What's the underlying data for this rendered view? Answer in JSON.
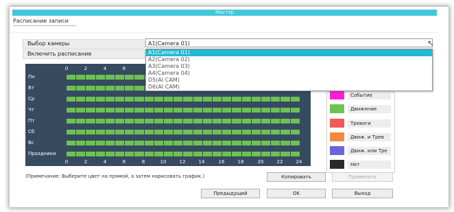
{
  "window": {
    "title": "Мастер"
  },
  "tab": {
    "label": "Расписание записи"
  },
  "camera_select": {
    "label": "Выбор камеры",
    "value": "A1(Camera 01)",
    "options": [
      "A1(Camera 01)",
      "A2(Camera 02)",
      "A3(Camera 03)",
      "A4(Camera 04)",
      "D5(AI CAM)",
      "D6(AI CAM)"
    ]
  },
  "enable_schedule": {
    "label": "Включить расписание"
  },
  "schedule": {
    "days": [
      "Пн",
      "Вт",
      "Ср",
      "Чт",
      "Пт",
      "Сб",
      "Вс",
      "Праздники"
    ],
    "hour_labels_top": [
      "0",
      "2",
      "4",
      "6"
    ],
    "hour_labels_bottom": [
      "0",
      "2",
      "4",
      "6",
      "8",
      "10",
      "12",
      "14",
      "16",
      "18",
      "20",
      "22",
      "24"
    ],
    "fill": "Движение",
    "fill_color": "#6dc253"
  },
  "legend": [
    {
      "label": "Событие",
      "color": "#ff1fd6"
    },
    {
      "label": "Движение",
      "color": "#6dc253"
    },
    {
      "label": "Тревоги",
      "color": "#f05a5a"
    },
    {
      "label": "Движ. и Трев",
      "color": "#f48a3e"
    },
    {
      "label": "Движ. или Тре",
      "color": "#6a66e0"
    },
    {
      "label": "Нет",
      "color": "#2a2a2a"
    }
  ],
  "note": "(Примечание: Выберите цвет на прямой, а затем нарисовать график.)",
  "buttons": {
    "copy": "Копировать",
    "apply": "Применить",
    "previous": "Предыдущий",
    "ok": "OK",
    "exit": "Выход"
  }
}
